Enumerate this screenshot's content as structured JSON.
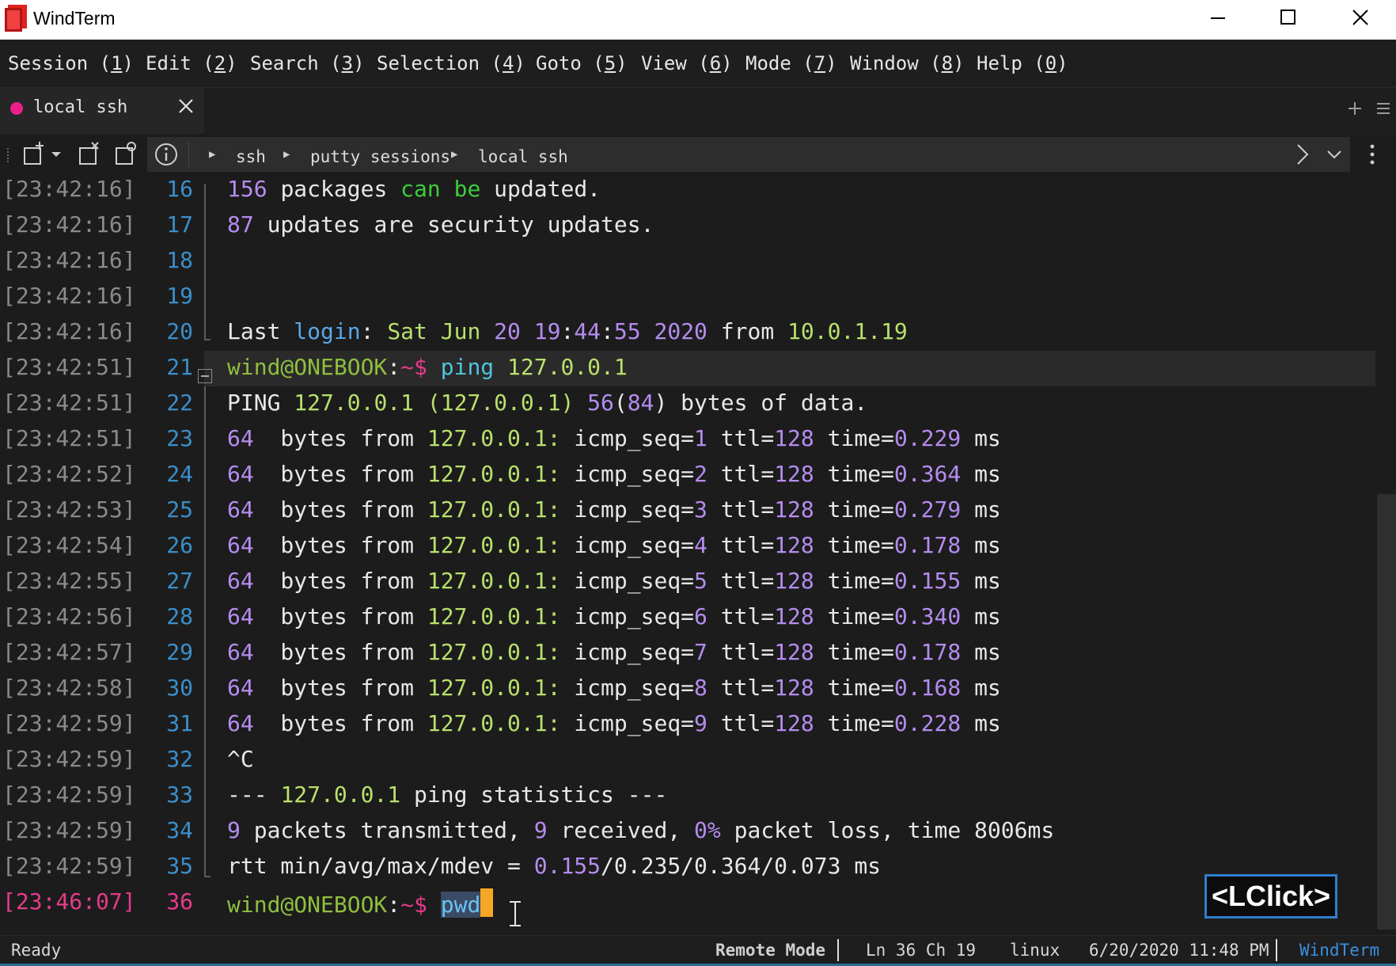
{
  "window": {
    "title": "WindTerm"
  },
  "menu": [
    {
      "label": "Session",
      "key": "1"
    },
    {
      "label": "Edit",
      "key": "2"
    },
    {
      "label": "Search",
      "key": "3"
    },
    {
      "label": "Selection",
      "key": "4"
    },
    {
      "label": "Goto",
      "key": "5"
    },
    {
      "label": "View",
      "key": "6"
    },
    {
      "label": "Mode",
      "key": "7"
    },
    {
      "label": "Window",
      "key": "8"
    },
    {
      "label": "Help",
      "key": "0"
    }
  ],
  "tab": {
    "label": "local ssh",
    "color": "#ec1f8c"
  },
  "breadcrumb": [
    "ssh",
    "putty sessions",
    "local ssh"
  ],
  "terminal": {
    "rows": [
      {
        "ts": "[23:42:16]",
        "ln": "16",
        "segs": [
          [
            "156 ",
            "c-purple"
          ],
          [
            "packages ",
            "c-white"
          ],
          [
            "can be ",
            "c-bgreen"
          ],
          [
            "updated.",
            "c-white"
          ]
        ]
      },
      {
        "ts": "[23:42:16]",
        "ln": "17",
        "segs": [
          [
            "87 ",
            "c-purple"
          ],
          [
            "updates are security updates.",
            "c-white"
          ]
        ]
      },
      {
        "ts": "[23:42:16]",
        "ln": "18",
        "segs": []
      },
      {
        "ts": "[23:42:16]",
        "ln": "19",
        "segs": []
      },
      {
        "ts": "[23:42:16]",
        "ln": "20",
        "segs": [
          [
            "Last ",
            "c-white"
          ],
          [
            "login",
            "c-blue"
          ],
          [
            ": ",
            "c-white"
          ],
          [
            "Sat Jun ",
            "c-lime"
          ],
          [
            "20 19",
            "c-purple"
          ],
          [
            ":",
            "c-white"
          ],
          [
            "44",
            "c-purple"
          ],
          [
            ":",
            "c-white"
          ],
          [
            "55 2020 ",
            "c-purple"
          ],
          [
            "from ",
            "c-white"
          ],
          [
            "10.0.1.19",
            "c-lime"
          ]
        ]
      },
      {
        "ts": "[23:42:51]",
        "ln": "21",
        "segs": [
          [
            "wind@ONEBOOK",
            "c-prompt"
          ],
          [
            ":",
            "c-white"
          ],
          [
            "~$ ",
            "c-pink"
          ],
          [
            "ping ",
            "c-cyan"
          ],
          [
            "127.0.0.1",
            "c-lime"
          ]
        ],
        "hl": true
      },
      {
        "ts": "[23:42:51]",
        "ln": "22",
        "segs": [
          [
            "PING ",
            "c-white"
          ],
          [
            "127.0.0.1 ",
            "c-lime"
          ],
          [
            "(127.0.0.1) ",
            "c-lime"
          ],
          [
            "56",
            "c-purple"
          ],
          [
            "(",
            "c-white"
          ],
          [
            "84",
            "c-purple"
          ],
          [
            ") bytes of data.",
            "c-white"
          ]
        ]
      },
      {
        "ts": "[23:42:51]",
        "ln": "23",
        "ping": [
          "1",
          "0.229"
        ]
      },
      {
        "ts": "[23:42:52]",
        "ln": "24",
        "ping": [
          "2",
          "0.364"
        ]
      },
      {
        "ts": "[23:42:53]",
        "ln": "25",
        "ping": [
          "3",
          "0.279"
        ]
      },
      {
        "ts": "[23:42:54]",
        "ln": "26",
        "ping": [
          "4",
          "0.178"
        ]
      },
      {
        "ts": "[23:42:55]",
        "ln": "27",
        "ping": [
          "5",
          "0.155"
        ]
      },
      {
        "ts": "[23:42:56]",
        "ln": "28",
        "ping": [
          "6",
          "0.340"
        ]
      },
      {
        "ts": "[23:42:57]",
        "ln": "29",
        "ping": [
          "7",
          "0.178"
        ]
      },
      {
        "ts": "[23:42:58]",
        "ln": "30",
        "ping": [
          "8",
          "0.168"
        ]
      },
      {
        "ts": "[23:42:59]",
        "ln": "31",
        "ping": [
          "9",
          "0.228"
        ]
      },
      {
        "ts": "[23:42:59]",
        "ln": "32",
        "segs": [
          [
            "^C",
            "c-white"
          ]
        ]
      },
      {
        "ts": "[23:42:59]",
        "ln": "33",
        "segs": [
          [
            "--- ",
            "c-white"
          ],
          [
            "127.0.0.1 ",
            "c-lime"
          ],
          [
            "ping statistics ---",
            "c-white"
          ]
        ]
      },
      {
        "ts": "[23:42:59]",
        "ln": "34",
        "segs": [
          [
            "9 ",
            "c-purple"
          ],
          [
            "packets transmitted, ",
            "c-white"
          ],
          [
            "9 ",
            "c-purple"
          ],
          [
            "received, ",
            "c-white"
          ],
          [
            "0%",
            "c-purple"
          ],
          [
            " packet loss, time 8006ms",
            "c-white"
          ]
        ]
      },
      {
        "ts": "[23:42:59]",
        "ln": "35",
        "segs": [
          [
            "rtt min/avg/max/mdev = ",
            "c-white"
          ],
          [
            "0.155",
            "c-purple"
          ],
          [
            "/0.235/0.364/0.073 ms",
            "c-white"
          ]
        ]
      },
      {
        "ts": "[23:46:07]",
        "ln": "36",
        "segs": [
          [
            "wind@ONEBOOK",
            "c-prompt"
          ],
          [
            ":",
            "c-white"
          ],
          [
            "~$ ",
            "c-pink"
          ],
          [
            "pwd",
            "c-cmdhl"
          ]
        ],
        "current": true,
        "cursor": true
      }
    ],
    "ping_words": {
      "bytes": "64 ",
      "from": " bytes from ",
      "host": "127.0.0.1: ",
      "seq": "icmp_seq=",
      "ttl": " ttl=",
      "ttl_val": "128",
      "time": " time=",
      "unit": " ms"
    }
  },
  "overlay": {
    "label": "<LClick>"
  },
  "status": {
    "ready": "Ready",
    "mode": "Remote Mode",
    "position": "Ln 36 Ch 19",
    "os": "linux",
    "datetime": "6/20/2020 11:48 PM",
    "app": "WindTerm"
  },
  "colors": {
    "accent": "#2e7fd0",
    "tab_dot": "#ec1f8c",
    "logo": "#e02020"
  }
}
